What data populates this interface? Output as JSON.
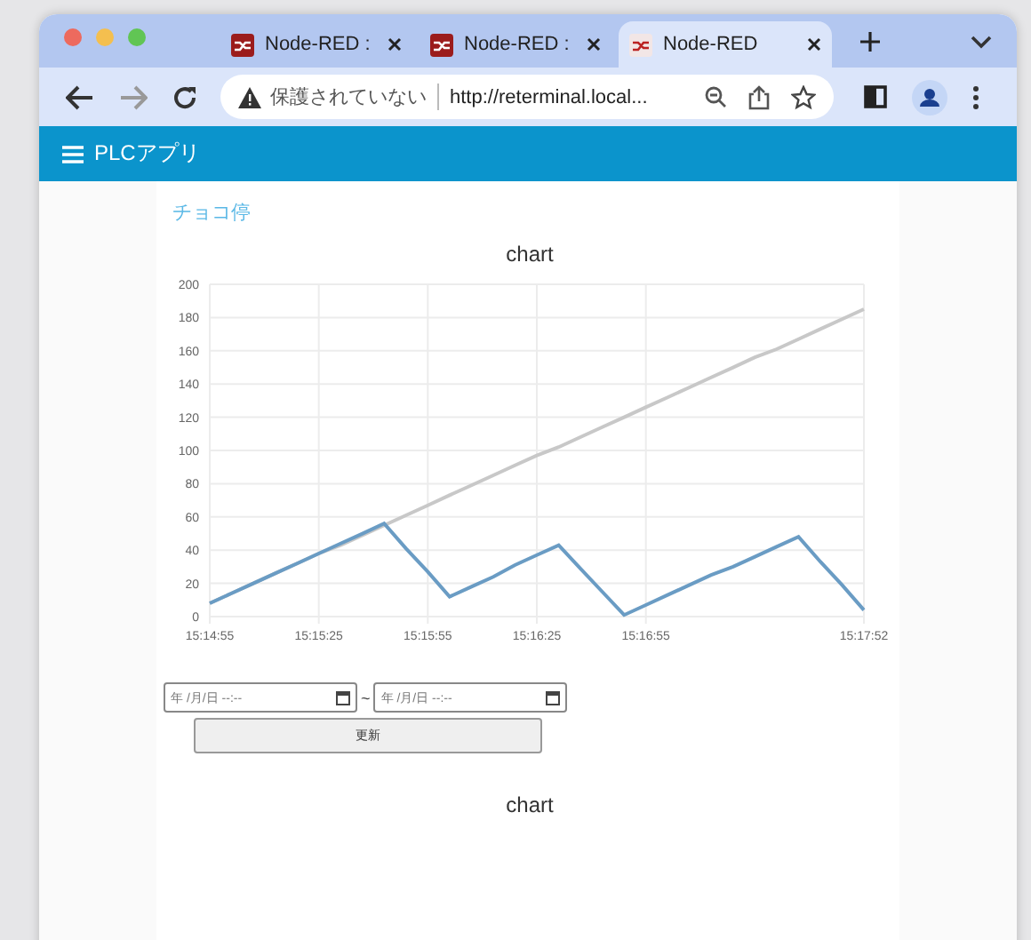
{
  "browser": {
    "tabs": [
      {
        "title": "Node-RED :",
        "selected": false
      },
      {
        "title": "Node-RED :",
        "selected": false
      },
      {
        "title": "Node-RED",
        "selected": true
      }
    ],
    "security_label": "保護されていない",
    "url": "http://reterminal.local..."
  },
  "app_bar": {
    "title": "PLCアプリ"
  },
  "panel": {
    "title": "チョコ停",
    "chart": {
      "chart_data": {
        "type": "line",
        "title": "chart",
        "grid": true,
        "categories": [
          "15:14:55",
          null,
          null,
          null,
          null,
          "15:15:25",
          null,
          null,
          null,
          null,
          "15:15:55",
          null,
          null,
          null,
          null,
          "15:16:25",
          null,
          null,
          null,
          null,
          "15:16:55",
          null,
          null,
          null,
          null,
          null,
          null,
          null,
          null,
          null,
          "15:17:52"
        ],
        "ylim": [
          0,
          200
        ],
        "yticks": [
          0,
          20,
          40,
          60,
          80,
          100,
          120,
          140,
          160,
          180,
          200
        ],
        "series": [
          {
            "color": "#c8c8c8",
            "values": [
              8,
              14,
              20,
              26,
              32,
              38,
              43,
              49,
              55,
              61,
              67,
              73,
              79,
              85,
              91,
              97,
              102,
              108,
              114,
              120,
              126,
              132,
              138,
              144,
              150,
              156,
              161,
              167,
              173,
              179,
              185
            ]
          },
          {
            "color": "#6a9cc4",
            "values": [
              8,
              14,
              20,
              26,
              32,
              38,
              44,
              50,
              56,
              41,
              27,
              12,
              18,
              24,
              31,
              37,
              43,
              29,
              15,
              1,
              7,
              13,
              19,
              25,
              30,
              36,
              42,
              48,
              33,
              19,
              4
            ]
          }
        ]
      }
    },
    "date_from": {
      "placeholder": "年 /月/日 --:--"
    },
    "separator": "~",
    "date_to": {
      "placeholder": "年 /月/日 --:--"
    },
    "update_button": "更新",
    "second_chart": {
      "title": "chart"
    }
  }
}
